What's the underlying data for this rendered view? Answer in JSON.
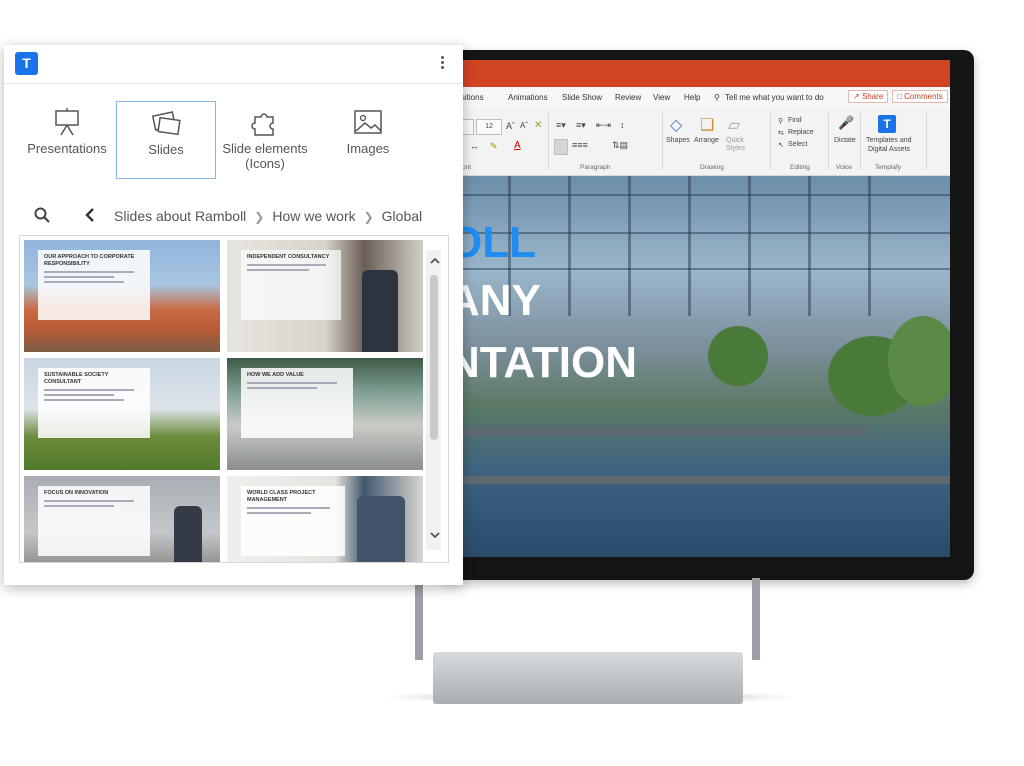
{
  "panel": {
    "logo_letter": "T",
    "categories": [
      {
        "label": "Presentations",
        "icon": "presentation-icon"
      },
      {
        "label": "Slides",
        "icon": "slides-icon"
      },
      {
        "label": "Slide elements (Icons)",
        "icon": "puzzle-icon"
      },
      {
        "label": "Images",
        "icon": "image-icon"
      }
    ],
    "active_category": "Slides",
    "breadcrumb": [
      "Slides about Ramboll",
      "How we work",
      "Global"
    ],
    "thumbnails": [
      {
        "title": "Our approach to corporate responsibility"
      },
      {
        "title": "Independent consultancy"
      },
      {
        "title": "Sustainable society consultant"
      },
      {
        "title": "How we add value"
      },
      {
        "title": "Focus on innovation"
      },
      {
        "title": "World class project management"
      }
    ]
  },
  "powerpoint": {
    "menu_tabs": [
      "ansitions",
      "Animations",
      "Slide Show",
      "Review",
      "View",
      "Help"
    ],
    "tell_me": "Tell me what you want to do",
    "share_label": "Share",
    "comments_label": "Comments",
    "ribbon": {
      "font_size": "12",
      "font_group": "Font",
      "paragraph_group": "Paragraph",
      "drawing_group": "Drawing",
      "editing_group": "Editing",
      "voice_group": "Voice",
      "templafy_group": "Templafy",
      "shapes": "Shapes",
      "arrange": "Arrange",
      "quick_styles": "Quick Styles",
      "find": "Find",
      "replace": "Replace",
      "select": "Select",
      "dictate": "Dictate",
      "templates_line1": "Templates and",
      "templates_line2": "Digital Assets"
    },
    "slide": {
      "line1": "OLL",
      "line2": "ANY",
      "line3": "NTATION"
    }
  },
  "colors": {
    "accent": "#1a73e8",
    "ppt_orange": "#d04423",
    "slide_blue": "#1e8cf0"
  }
}
